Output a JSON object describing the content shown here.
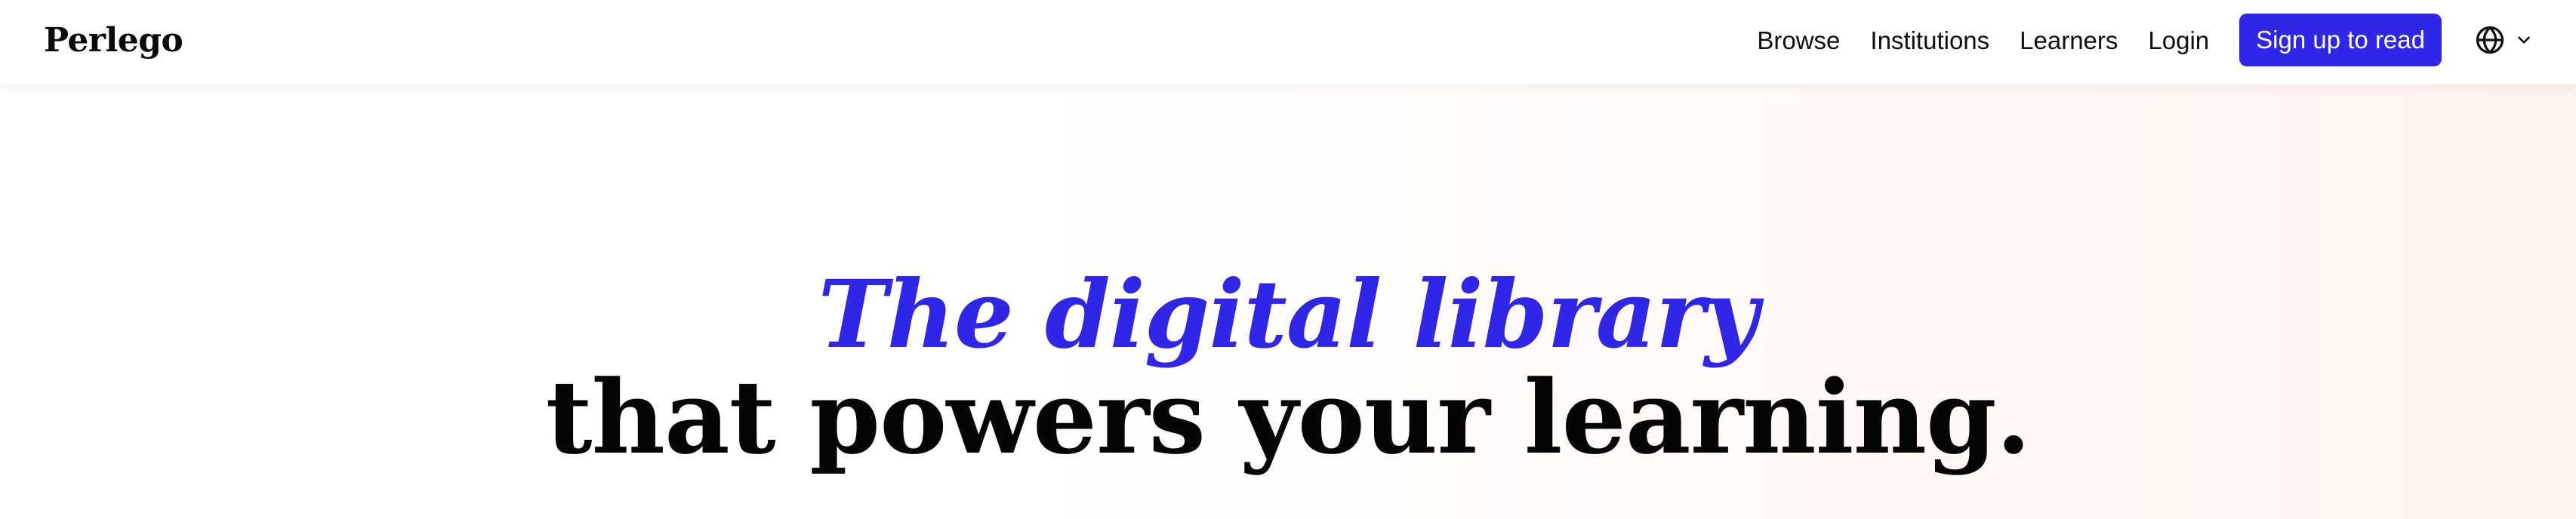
{
  "header": {
    "logo_text": "Perlego",
    "nav": {
      "browse": "Browse",
      "institutions": "Institutions",
      "learners": "Learners",
      "login": "Login"
    },
    "cta_label": "Sign up to read",
    "language_icon": "globe-icon",
    "language_chevron_icon": "chevron-down-icon"
  },
  "hero": {
    "headline_accent": "The digital library",
    "headline_main": "that powers your learning."
  },
  "colors": {
    "brand_accent": "#2F26E7",
    "text_primary": "#050505",
    "header_bg": "#FFFFFF"
  }
}
